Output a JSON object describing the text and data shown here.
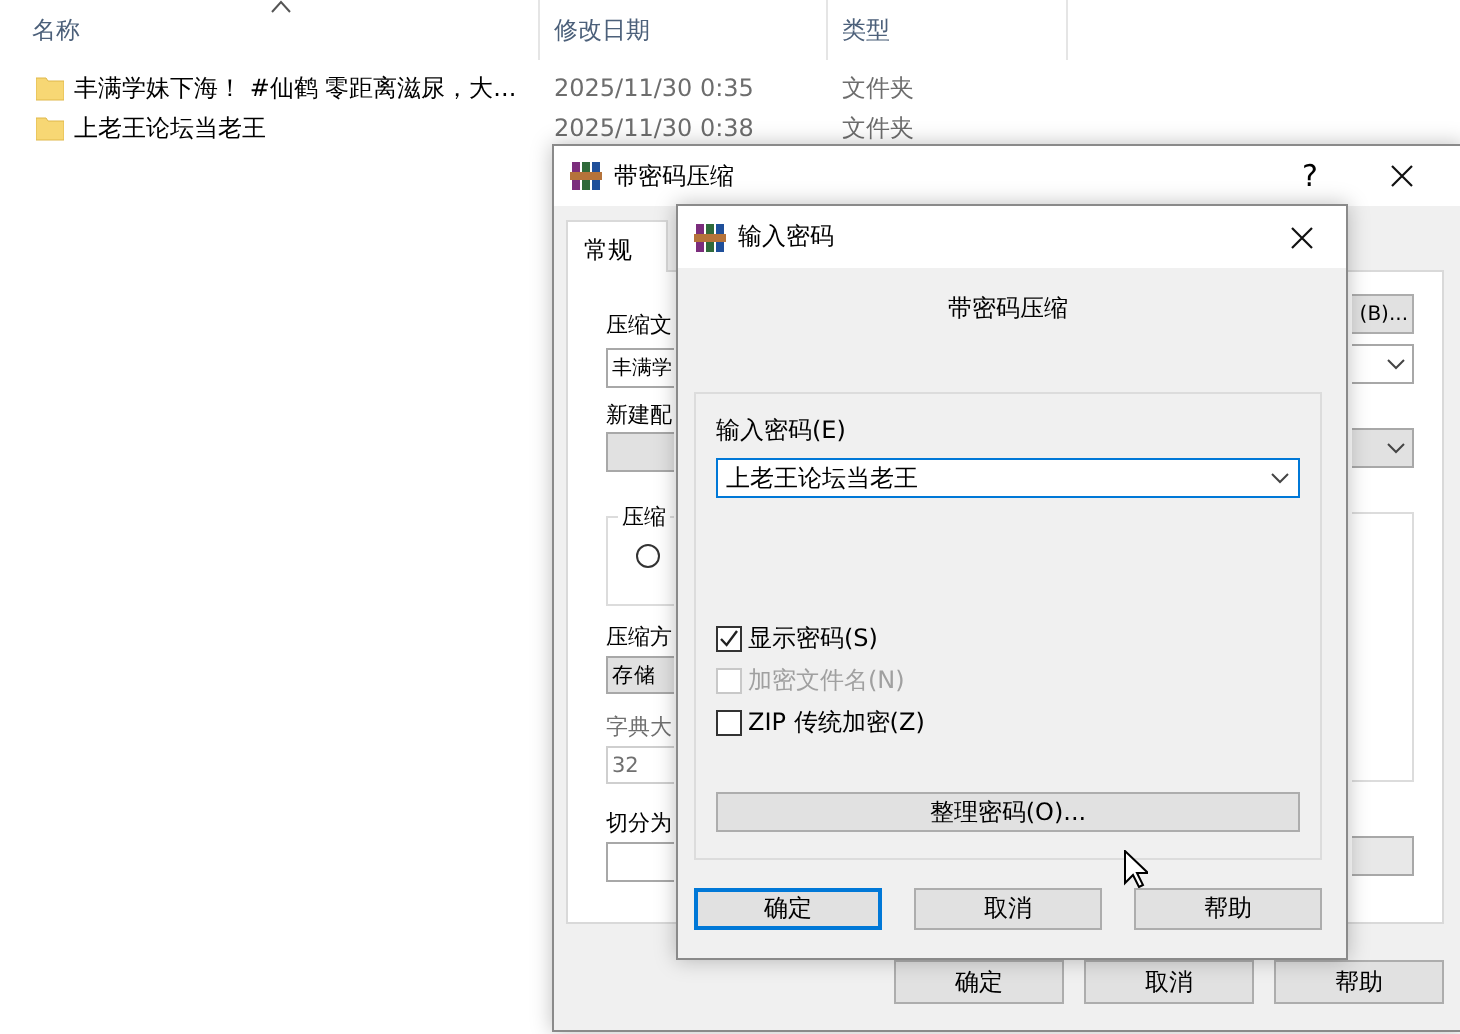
{
  "explorer": {
    "columns": [
      "名称",
      "修改日期",
      "类型"
    ],
    "rows": [
      {
        "name": "丰满学妹下海！ #仙鹤 零距离滋尿，大...",
        "modified": "2025/11/30 0:35",
        "type": "文件夹"
      },
      {
        "name": "上老王论坛当老王",
        "modified": "2025/11/30 0:38",
        "type": "文件夹"
      }
    ]
  },
  "archive_dialog": {
    "title": "带密码压缩",
    "help": "?",
    "tabs": [
      {
        "label": "常规",
        "selected": true
      }
    ],
    "archive_name": {
      "label": "压缩文",
      "value": "丰满学"
    },
    "profile": {
      "label": "新建配"
    },
    "format_group": {
      "label": "压缩",
      "radio_selected": false
    },
    "method": {
      "label": "压缩方",
      "value": "存储"
    },
    "dictionary": {
      "label": "字典大",
      "value": "32",
      "disabled": true
    },
    "split": {
      "label": "切分为"
    },
    "browse_button": "(B)...",
    "buttons": [
      "确定",
      "取消",
      "帮助"
    ]
  },
  "password_dialog": {
    "title": "输入密码",
    "heading": "带密码压缩",
    "label": "输入密码(E)",
    "value": "上老王论坛当老王",
    "options": [
      {
        "label": "显示密码(S)",
        "checked": true,
        "disabled": false
      },
      {
        "label": "加密文件名(N)",
        "checked": false,
        "disabled": true
      },
      {
        "label": "ZIP 传统加密(Z)",
        "checked": false,
        "disabled": false
      }
    ],
    "organize_button": "整理密码(O)...",
    "buttons": [
      {
        "label": "确定",
        "focused": true
      },
      {
        "label": "取消",
        "focused": false
      },
      {
        "label": "帮助",
        "focused": false
      }
    ]
  }
}
